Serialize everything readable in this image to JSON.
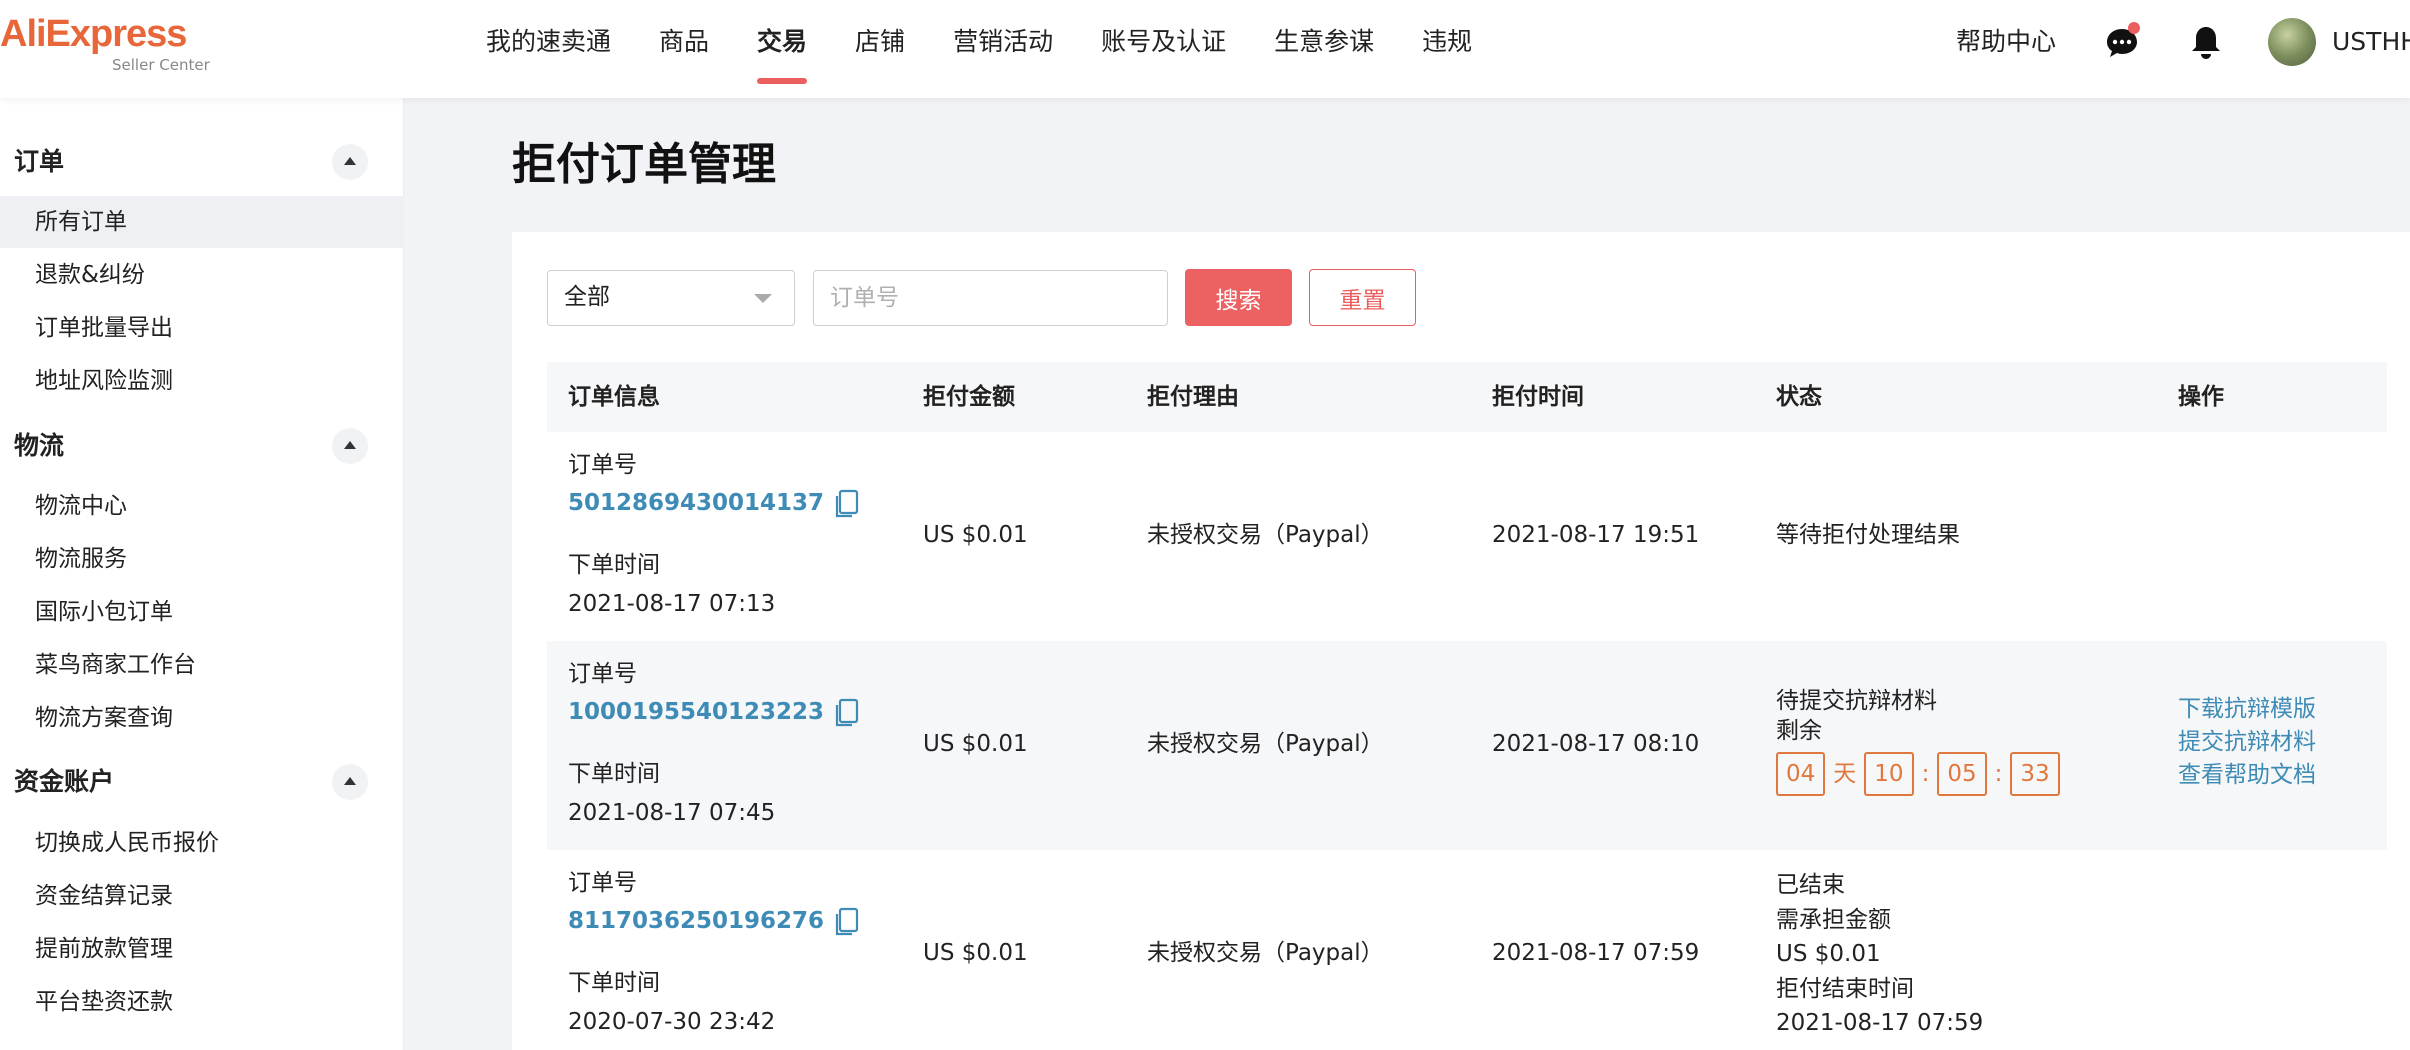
{
  "brand": {
    "logo_main": "AliExpress",
    "logo_sub": "Seller Center",
    "accent": "#ec5f5f",
    "link_color": "#3e8bb5",
    "countdown_color": "#e0783d"
  },
  "nav": {
    "items": [
      "我的速卖通",
      "商品",
      "交易",
      "店铺",
      "营销活动",
      "账号及认证",
      "生意参谋",
      "违规"
    ],
    "active": "交易",
    "help": "帮助中心",
    "username": "USTHH"
  },
  "icons": {
    "chat": "chat-bubble-icon",
    "notification": "bell-icon",
    "copy": "copy-icon"
  },
  "sidebar": {
    "groups": [
      {
        "title": "订单",
        "items": [
          "所有订单",
          "退款&纠纷",
          "订单批量导出",
          "地址风险监测"
        ]
      },
      {
        "title": "物流",
        "items": [
          "物流中心",
          "物流服务",
          "国际小包订单",
          "菜鸟商家工作台",
          "物流方案查询"
        ]
      },
      {
        "title": "资金账户",
        "items": [
          "切换成人民币报价",
          "资金结算记录",
          "提前放款管理",
          "平台垫资还款"
        ]
      }
    ],
    "active_item": "所有订单"
  },
  "page": {
    "title": "拒付订单管理"
  },
  "filters": {
    "status_select": "全部",
    "order_input_placeholder": "订单号",
    "search_label": "搜索",
    "reset_label": "重置"
  },
  "table": {
    "headers": [
      "订单信息",
      "拒付金额",
      "拒付理由",
      "拒付时间",
      "状态",
      "操作"
    ],
    "rows": [
      {
        "order_label": "订单号",
        "order_no": "5012869430014137",
        "placed_label": "下单时间",
        "placed_time": "2021-08-17 07:13",
        "amount": "US $0.01",
        "reason": "未授权交易（Paypal）",
        "chargeback_time": "2021-08-17 19:51",
        "status": [
          "等待拒付处理结果"
        ]
      },
      {
        "order_label": "订单号",
        "order_no": "1000195540123223",
        "placed_label": "下单时间",
        "placed_time": "2021-08-17 07:45",
        "amount": "US $0.01",
        "reason": "未授权交易（Paypal）",
        "chargeback_time": "2021-08-17 08:10",
        "status": [
          "待提交抗辩材料",
          "剩余"
        ],
        "countdown": {
          "days": "04",
          "day_unit": "天",
          "hours": "10",
          "minutes": "05",
          "seconds": "33",
          "sep": ":"
        },
        "actions": [
          "下载抗辩模版",
          "提交抗辩材料",
          "查看帮助文档"
        ]
      },
      {
        "order_label": "订单号",
        "order_no": "8117036250196276",
        "placed_label": "下单时间",
        "placed_time": "2020-07-30 23:42",
        "amount": "US $0.01",
        "reason": "未授权交易（Paypal）",
        "chargeback_time": "2021-08-17 07:59",
        "status": [
          "已结束",
          "需承担金额",
          "US $0.01",
          "拒付结束时间",
          "2021-08-17 07:59"
        ]
      }
    ]
  }
}
